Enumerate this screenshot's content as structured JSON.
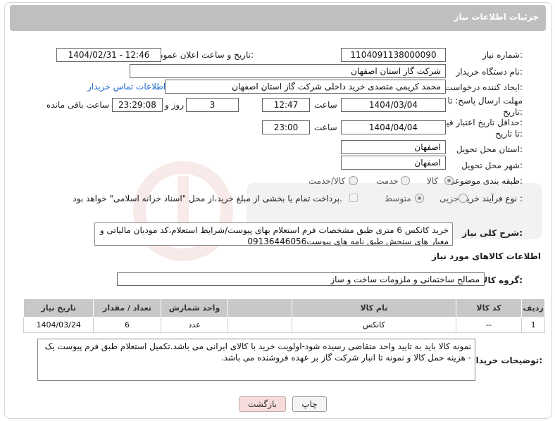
{
  "header": {
    "title": "جزئیات اطلاعات نیاز"
  },
  "fields": {
    "need_number_label": "شماره نیاز:",
    "need_number": "1104091138000090",
    "announce_label": "تاریخ و ساعت اعلان عمومی:",
    "announce_value": "1404/02/31 - 12:46",
    "buyer_org_label": "نام دستگاه خریدار:",
    "buyer_org": "شرکت گاز استان اصفهان",
    "creator_label": "ایجاد کننده درخواست:",
    "creator": "محمد کریمی متصدی خرید داخلی شرکت گاز استان اصفهان",
    "contact_link": "اطلاعات تماس خریدار",
    "deadline_label_1": "مهلت ارسال پاسخ: تا",
    "deadline_label_2": "تاریخ:",
    "deadline_date": "1404/03/04",
    "time_label": "ساعت",
    "deadline_time": "12:47",
    "days_value": "3",
    "days_label": "روز و",
    "remaining_time": "23:29:08",
    "remaining_label": "ساعت باقی مانده",
    "min_price_label_1": "حداقل تاریخ اعتبار قیمت:",
    "min_price_label_2": "تا تاریخ:",
    "validity_date": "1404/04/04",
    "validity_time": "23:00",
    "province_label": "استان محل تحویل:",
    "province": "اصفهان",
    "city_label": "شهر محل تحویل:",
    "city": "اصفهان",
    "category_label": "طبقه بندی موضوعی:",
    "category_options": [
      "کالا",
      "خدمت",
      "کالا/خدمت"
    ],
    "process_label": "نوع فرآیند خرید :",
    "process_options": [
      "جزیی",
      "متوسط"
    ],
    "payment_note": "پرداخت تمام یا بخشی از مبلغ خرید،از محل \"اسناد خزانه اسلامی\" خواهد بود."
  },
  "description": {
    "label": "شرح کلی نیاز:",
    "text": "خرید کانکس 6 متری طبق مشخصات فرم استعلام بهای پیوست/شرایط  استعلام،کد مودیان مالیاتی و معیار های سنجش طبق نامه های پیوست09136446056"
  },
  "goods": {
    "section_title": "اطلاعات کالاهای مورد نیاز",
    "group_label": "گروه کالا:",
    "group_value": "مصالح ساختمانی و ملزومات ساخت و ساز",
    "columns": [
      "ردیف",
      "کد کالا",
      "نام کالا",
      "واحد شمارش",
      "تعداد / مقدار",
      "تاریخ نیاز"
    ],
    "rows": [
      {
        "row": "1",
        "code": "--",
        "name": "کانکس",
        "unit": "عدد",
        "qty": "6",
        "date": "1404/03/24"
      }
    ]
  },
  "buyer_notes": {
    "label": "توضیحات خریدار:",
    "text": "نمونه کالا باید به تایید واحد متقاضی رسیده شود-اولویت خرید با کالای ایرانی می باشد.تکمیل استعلام طبق فرم پیوست یک - هزینه حمل کالا و نمونه تا انبار شرکت گاز بر عهده فروشنده می باشد."
  },
  "buttons": {
    "print": "چاپ",
    "back": "بازگشت"
  }
}
